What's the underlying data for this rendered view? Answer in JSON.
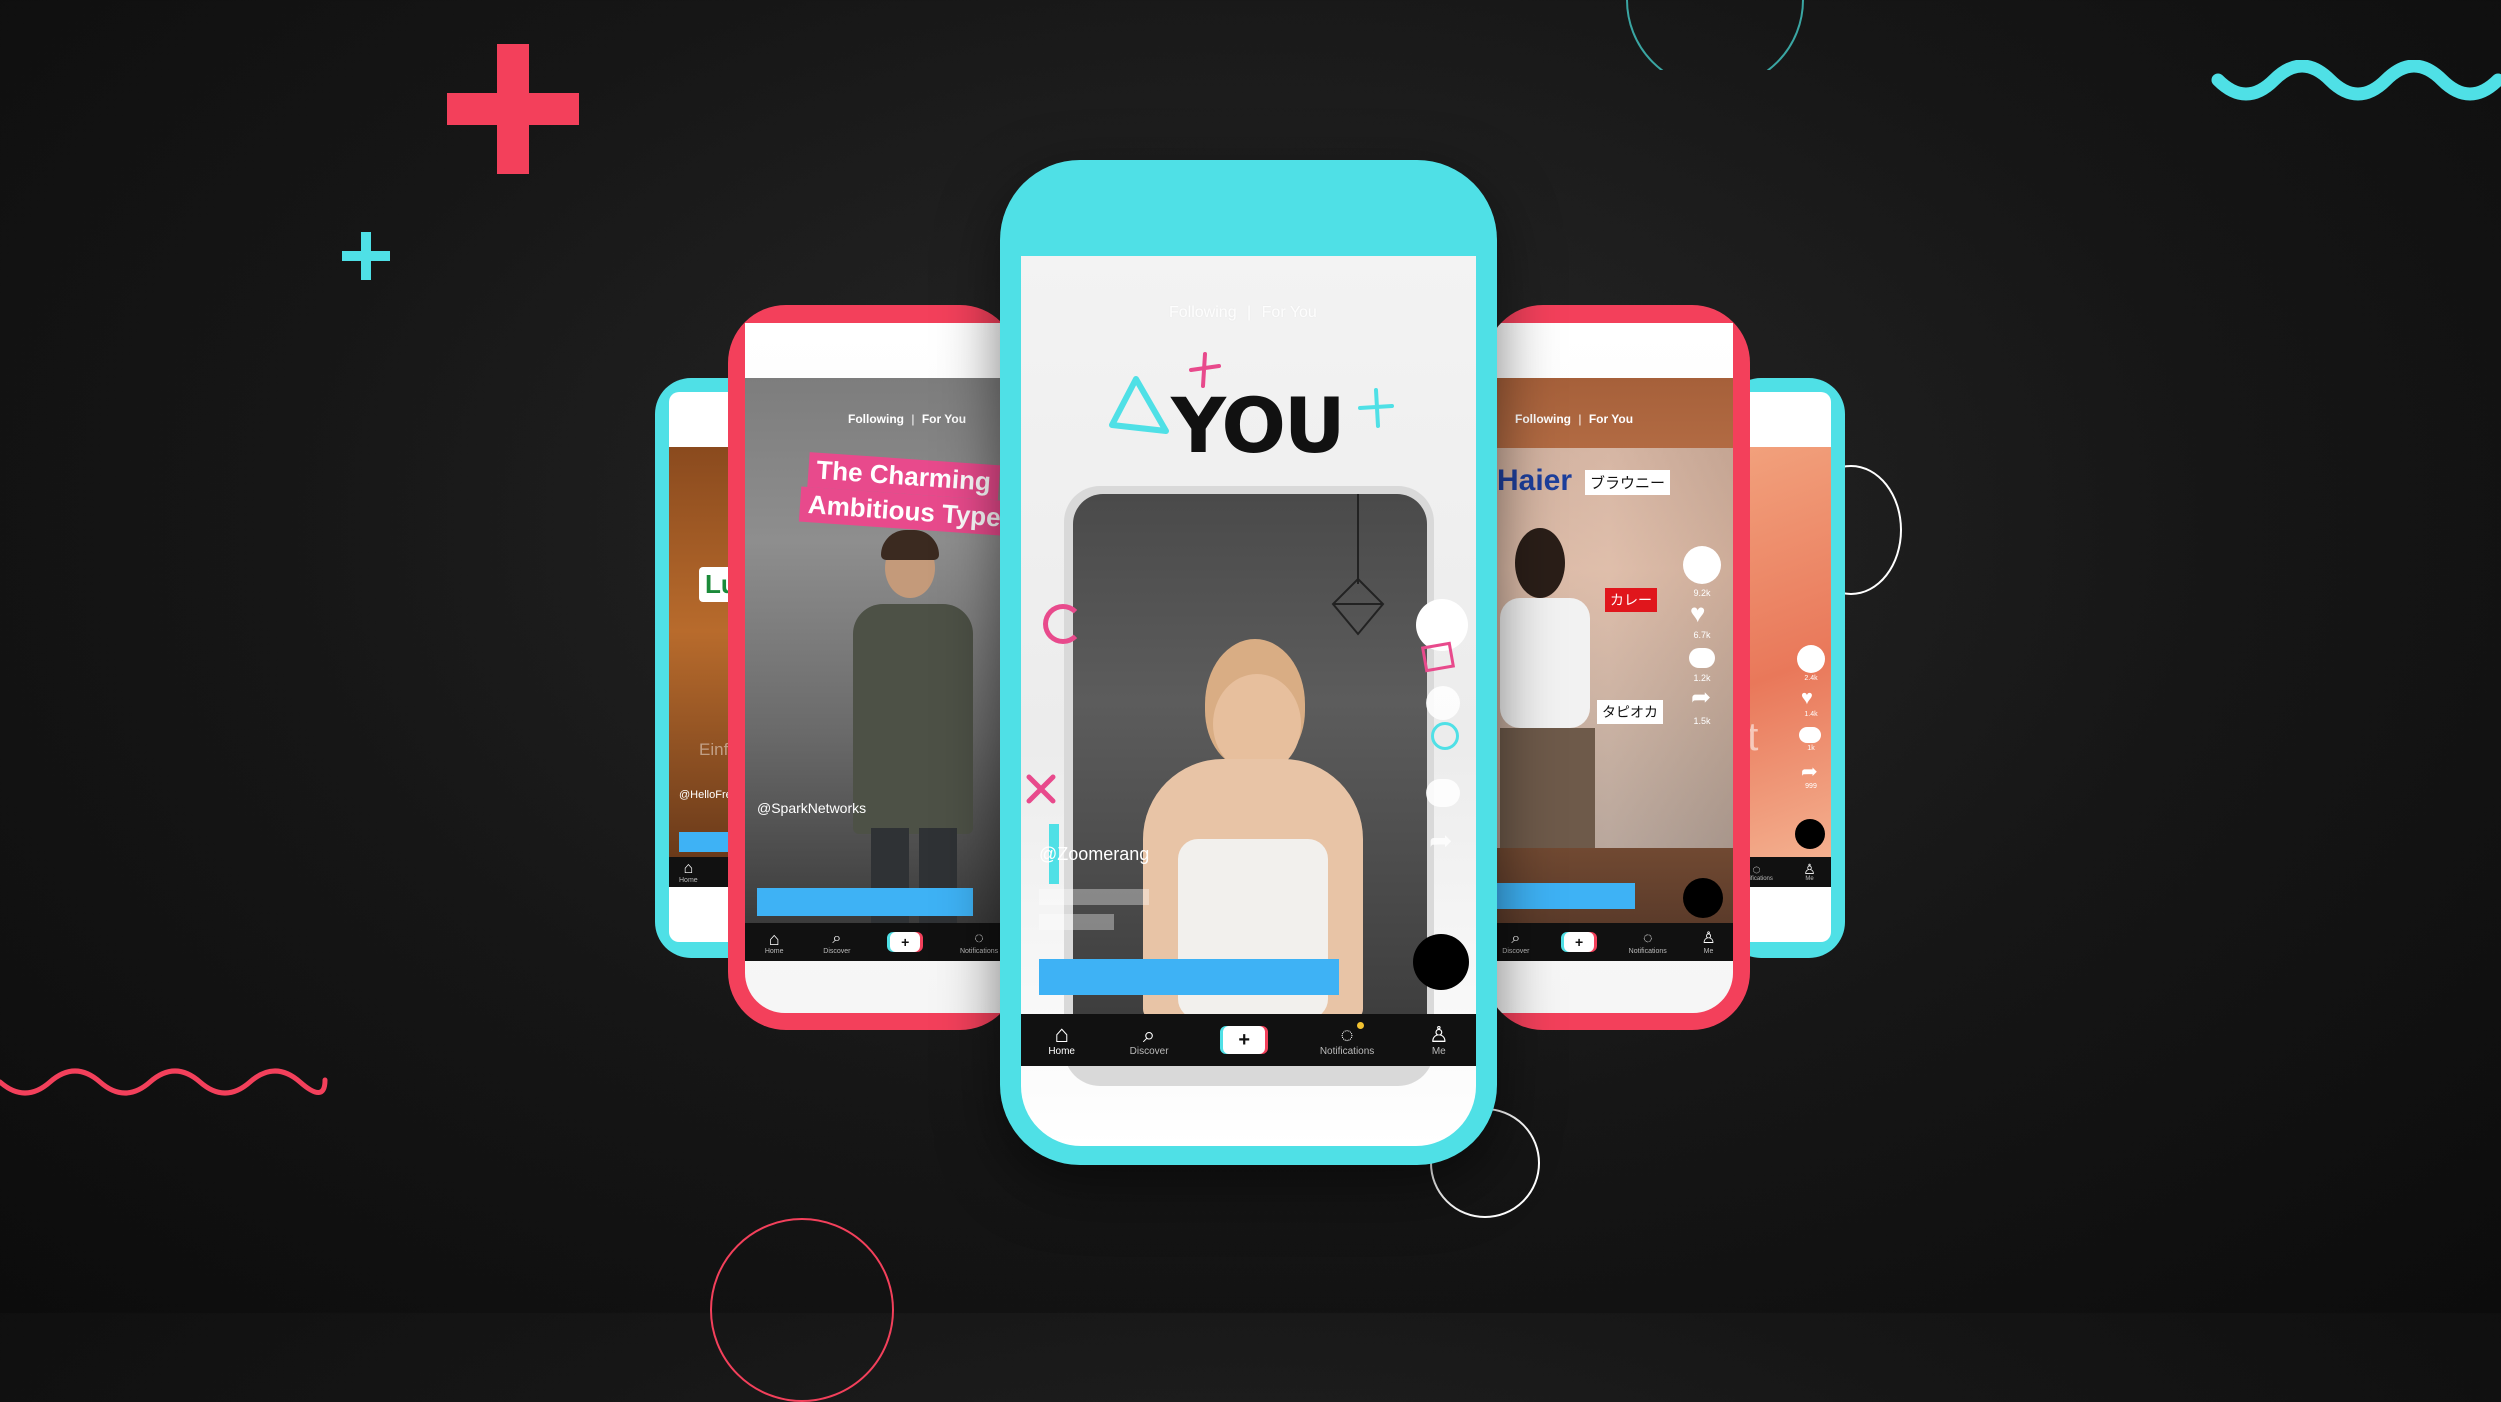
{
  "colors": {
    "accent_red": "#f3405b",
    "accent_cyan": "#4fe0e6",
    "progress_blue": "#3eb2f5",
    "background": "#161616"
  },
  "center_phone": {
    "top_nav": {
      "following": "Following",
      "separator": "|",
      "for_you": "For You"
    },
    "headline": "YOU",
    "handle": "@Zoomerang",
    "nav": [
      "Home",
      "Discover",
      "+",
      "Notifications",
      "Me"
    ]
  },
  "left_phone": {
    "top_nav": {
      "following": "Following",
      "separator": "|",
      "for_you": "For You"
    },
    "banner_line1": "The Charming",
    "banner_line2": "Ambitious Type",
    "handle": "@SparkNetworks",
    "nav": [
      "Home",
      "Discover",
      "+",
      "Notifications"
    ]
  },
  "far_left_phone": {
    "label": "Lu",
    "faded_text": "Einf",
    "handle": "@HelloFre",
    "nav": [
      "Home"
    ]
  },
  "right_phone": {
    "top_nav": {
      "following": "Following",
      "separator": "|",
      "for_you": "For You"
    },
    "brand": "Haier",
    "tag1": "ブラウニー",
    "tag2": "カレー",
    "tag3": "タピオカ",
    "counts": [
      "9.2k",
      "6.7k",
      "1.2k",
      "1.5k"
    ],
    "nav": [
      "Discover",
      "+",
      "Notifications",
      "Me"
    ]
  },
  "far_right_phone": {
    "faded_text": "nt",
    "counts": [
      "2.4k",
      "1.4k",
      "1k",
      "999"
    ],
    "nav": [
      "Notifications",
      "Me"
    ]
  }
}
